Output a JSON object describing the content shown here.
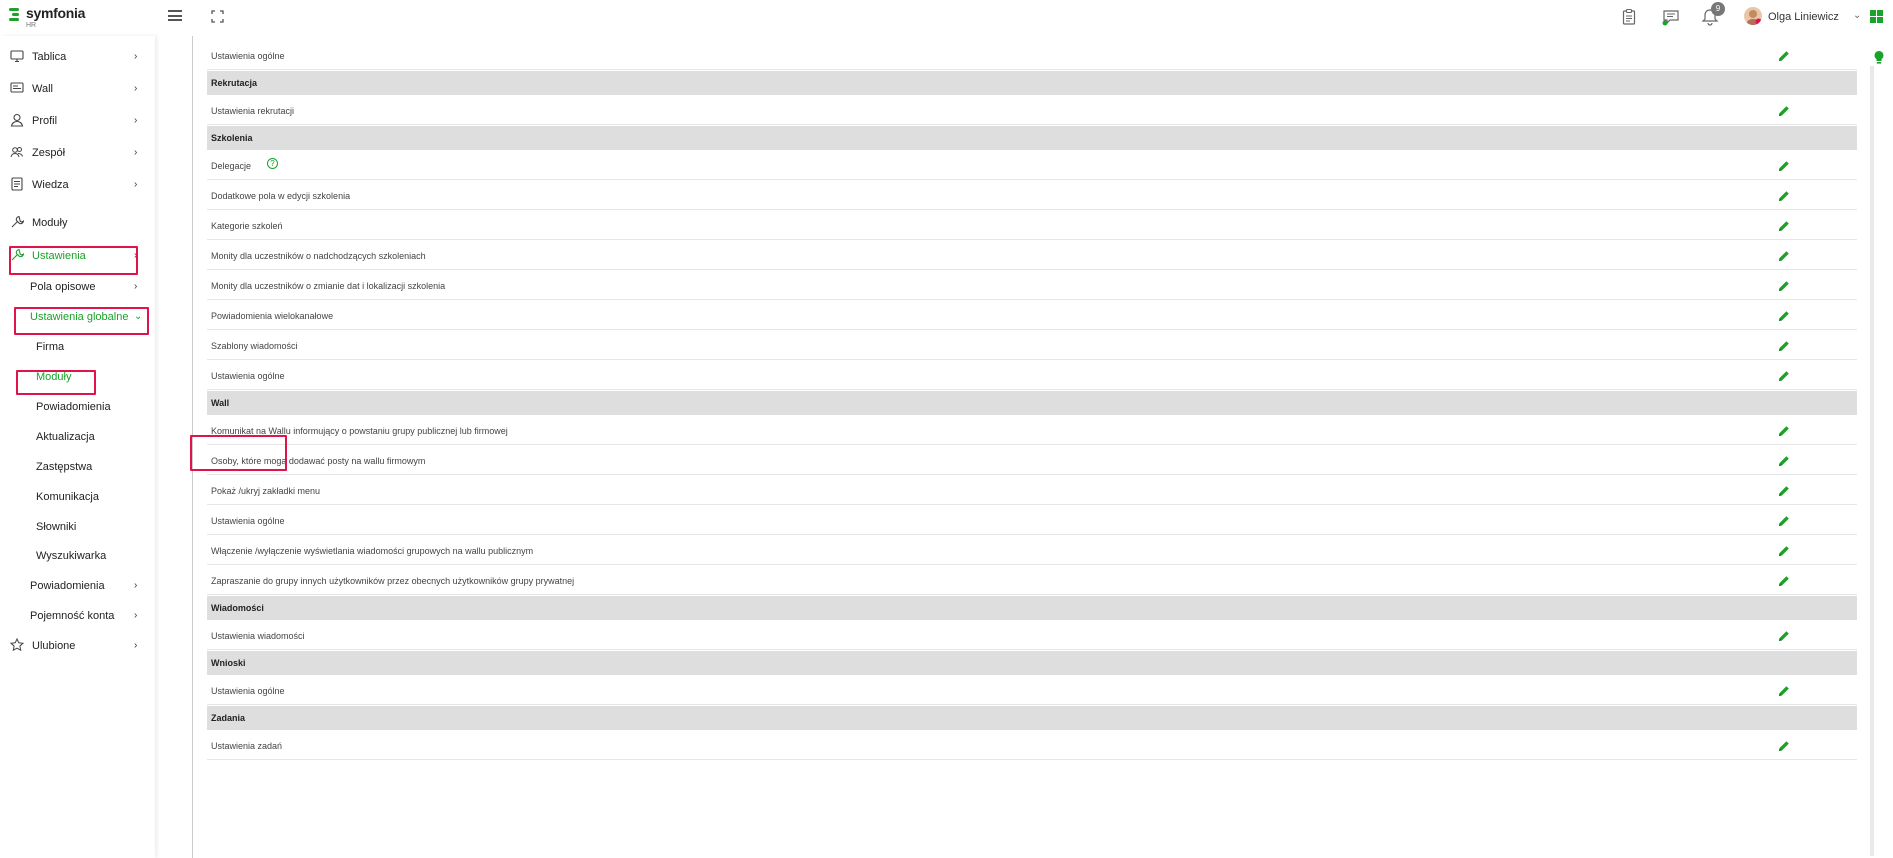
{
  "header": {
    "logo_name": "symfonia",
    "logo_sub": "HR",
    "notification_count": "9",
    "user_name": "Olga Liniewicz",
    "user_caret": "⌄"
  },
  "sidebar": {
    "items": [
      {
        "label": "Tablica",
        "icon": "monitor-icon",
        "chevron": "›"
      },
      {
        "label": "Wall",
        "icon": "wall-icon",
        "chevron": "›"
      },
      {
        "label": "Profil",
        "icon": "user-icon",
        "chevron": "›"
      },
      {
        "label": "Zespół",
        "icon": "team-icon",
        "chevron": "›"
      },
      {
        "label": "Wiedza",
        "icon": "document-icon",
        "chevron": "›"
      },
      {
        "label": "Moduły",
        "icon": "wrench-icon"
      },
      {
        "label": "Ustawienia",
        "icon": "wrench-icon",
        "chevron": "›"
      },
      {
        "label": "Pola opisowe",
        "chevron": "›"
      },
      {
        "label": "Ustawienia globalne",
        "chevron": "⌄"
      },
      {
        "label": "Firma"
      },
      {
        "label": "Moduły"
      },
      {
        "label": "Powiadomienia"
      },
      {
        "label": "Aktualizacja"
      },
      {
        "label": "Zastępstwa"
      },
      {
        "label": "Komunikacja"
      },
      {
        "label": "Słowniki"
      },
      {
        "label": "Wyszukiwarka"
      },
      {
        "label": "Powiadomienia",
        "chevron": "›"
      },
      {
        "label": "Pojemność konta",
        "chevron": "›"
      },
      {
        "label": "Ulubione",
        "icon": "star-icon",
        "chevron": "›"
      }
    ]
  },
  "content": {
    "rows": [
      {
        "type": "item",
        "label": "Ustawienia ogólne"
      },
      {
        "type": "section",
        "label": "Rekrutacja"
      },
      {
        "type": "item",
        "label": "Ustawienia rekrutacji"
      },
      {
        "type": "section",
        "label": "Szkolenia"
      },
      {
        "type": "item",
        "label": "Delegacje"
      },
      {
        "type": "item",
        "label": "Dodatkowe pola w edycji szkolenia"
      },
      {
        "type": "item",
        "label": "Kategorie szkoleń"
      },
      {
        "type": "item",
        "label": "Monity dla uczestników o nadchodzących szkoleniach"
      },
      {
        "type": "item",
        "label": "Monity dla uczestników o zmianie dat i lokalizacji szkolenia"
      },
      {
        "type": "item",
        "label": "Powiadomienia wielokanałowe"
      },
      {
        "type": "item",
        "label": "Szablony wiadomości"
      },
      {
        "type": "item",
        "label": "Ustawienia ogólne"
      },
      {
        "type": "section",
        "label": "Wall"
      },
      {
        "type": "item",
        "label": "Komunikat na Wallu informujący o powstaniu grupy publicznej lub firmowej"
      },
      {
        "type": "item",
        "label": "Osoby, które mogą dodawać posty na wallu firmowym"
      },
      {
        "type": "item",
        "label": "Pokaż /ukryj zakładki menu"
      },
      {
        "type": "item",
        "label": "Ustawienia ogólne"
      },
      {
        "type": "item",
        "label": "Włączenie /wyłączenie wyświetlania wiadomości grupowych na wallu publicznym"
      },
      {
        "type": "item",
        "label": "Zapraszanie do grupy innych użytkowników przez obecnych użytkowników grupy prywatnej"
      },
      {
        "type": "section",
        "label": "Wiadomości"
      },
      {
        "type": "item",
        "label": "Ustawienia wiadomości"
      },
      {
        "type": "section",
        "label": "Wnioski"
      },
      {
        "type": "item",
        "label": "Ustawienia ogólne"
      },
      {
        "type": "section",
        "label": "Zadania"
      },
      {
        "type": "item",
        "label": "Ustawienia zadań"
      }
    ],
    "help_glyph": "?"
  },
  "colors": {
    "accent": "#1aa229",
    "highlight": "#e0134b",
    "section_bg": "#dedede"
  }
}
